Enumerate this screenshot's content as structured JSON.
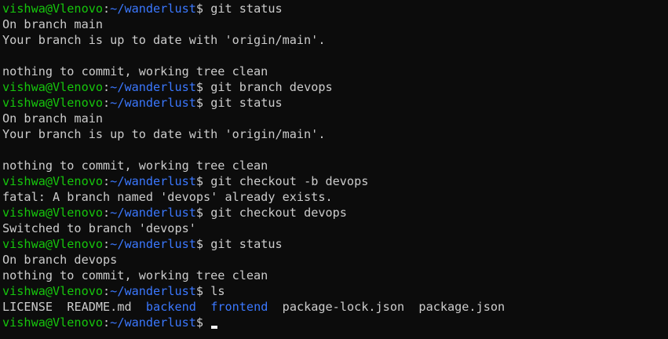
{
  "colors": {
    "background": "#0c0c0c",
    "text": "#cccccc",
    "prompt_user": "#16c60c",
    "prompt_path": "#3b78ff",
    "directory": "#3b78ff",
    "cursor": "#f2f2f2"
  },
  "terminal": {
    "lines": [
      {
        "type": "prompt",
        "user": "vishwa@Vlenovo",
        "sep": ":",
        "path": "~/wanderlust",
        "symbol": "$ ",
        "command": "git status"
      },
      {
        "type": "output",
        "segments": [
          {
            "text": "On branch main",
            "color": "white"
          }
        ]
      },
      {
        "type": "output",
        "segments": [
          {
            "text": "Your branch is up to date with 'origin/main'.",
            "color": "white"
          }
        ]
      },
      {
        "type": "output",
        "segments": [
          {
            "text": "",
            "color": "white"
          }
        ]
      },
      {
        "type": "output",
        "segments": [
          {
            "text": "nothing to commit, working tree clean",
            "color": "white"
          }
        ]
      },
      {
        "type": "prompt",
        "user": "vishwa@Vlenovo",
        "sep": ":",
        "path": "~/wanderlust",
        "symbol": "$ ",
        "command": "git branch devops"
      },
      {
        "type": "prompt",
        "user": "vishwa@Vlenovo",
        "sep": ":",
        "path": "~/wanderlust",
        "symbol": "$ ",
        "command": "git status"
      },
      {
        "type": "output",
        "segments": [
          {
            "text": "On branch main",
            "color": "white"
          }
        ]
      },
      {
        "type": "output",
        "segments": [
          {
            "text": "Your branch is up to date with 'origin/main'.",
            "color": "white"
          }
        ]
      },
      {
        "type": "output",
        "segments": [
          {
            "text": "",
            "color": "white"
          }
        ]
      },
      {
        "type": "output",
        "segments": [
          {
            "text": "nothing to commit, working tree clean",
            "color": "white"
          }
        ]
      },
      {
        "type": "prompt",
        "user": "vishwa@Vlenovo",
        "sep": ":",
        "path": "~/wanderlust",
        "symbol": "$ ",
        "command": "git checkout -b devops"
      },
      {
        "type": "output",
        "segments": [
          {
            "text": "fatal: A branch named 'devops' already exists.",
            "color": "white"
          }
        ]
      },
      {
        "type": "prompt",
        "user": "vishwa@Vlenovo",
        "sep": ":",
        "path": "~/wanderlust",
        "symbol": "$ ",
        "command": "git checkout devops"
      },
      {
        "type": "output",
        "segments": [
          {
            "text": "Switched to branch 'devops'",
            "color": "white"
          }
        ]
      },
      {
        "type": "prompt",
        "user": "vishwa@Vlenovo",
        "sep": ":",
        "path": "~/wanderlust",
        "symbol": "$ ",
        "command": "git status"
      },
      {
        "type": "output",
        "segments": [
          {
            "text": "On branch devops",
            "color": "white"
          }
        ]
      },
      {
        "type": "output",
        "segments": [
          {
            "text": "nothing to commit, working tree clean",
            "color": "white"
          }
        ]
      },
      {
        "type": "prompt",
        "user": "vishwa@Vlenovo",
        "sep": ":",
        "path": "~/wanderlust",
        "symbol": "$ ",
        "command": "ls"
      },
      {
        "type": "output",
        "segments": [
          {
            "text": "LICENSE",
            "color": "white"
          },
          {
            "text": "  ",
            "color": "white"
          },
          {
            "text": "README.md",
            "color": "white"
          },
          {
            "text": "  ",
            "color": "white"
          },
          {
            "text": "backend",
            "color": "blue"
          },
          {
            "text": "  ",
            "color": "white"
          },
          {
            "text": "frontend",
            "color": "blue"
          },
          {
            "text": "  ",
            "color": "white"
          },
          {
            "text": "package-lock.json",
            "color": "white"
          },
          {
            "text": "  ",
            "color": "white"
          },
          {
            "text": "package.json",
            "color": "white"
          }
        ]
      },
      {
        "type": "prompt",
        "user": "vishwa@Vlenovo",
        "sep": ":",
        "path": "~/wanderlust",
        "symbol": "$ ",
        "command": "",
        "cursor": true
      }
    ]
  }
}
